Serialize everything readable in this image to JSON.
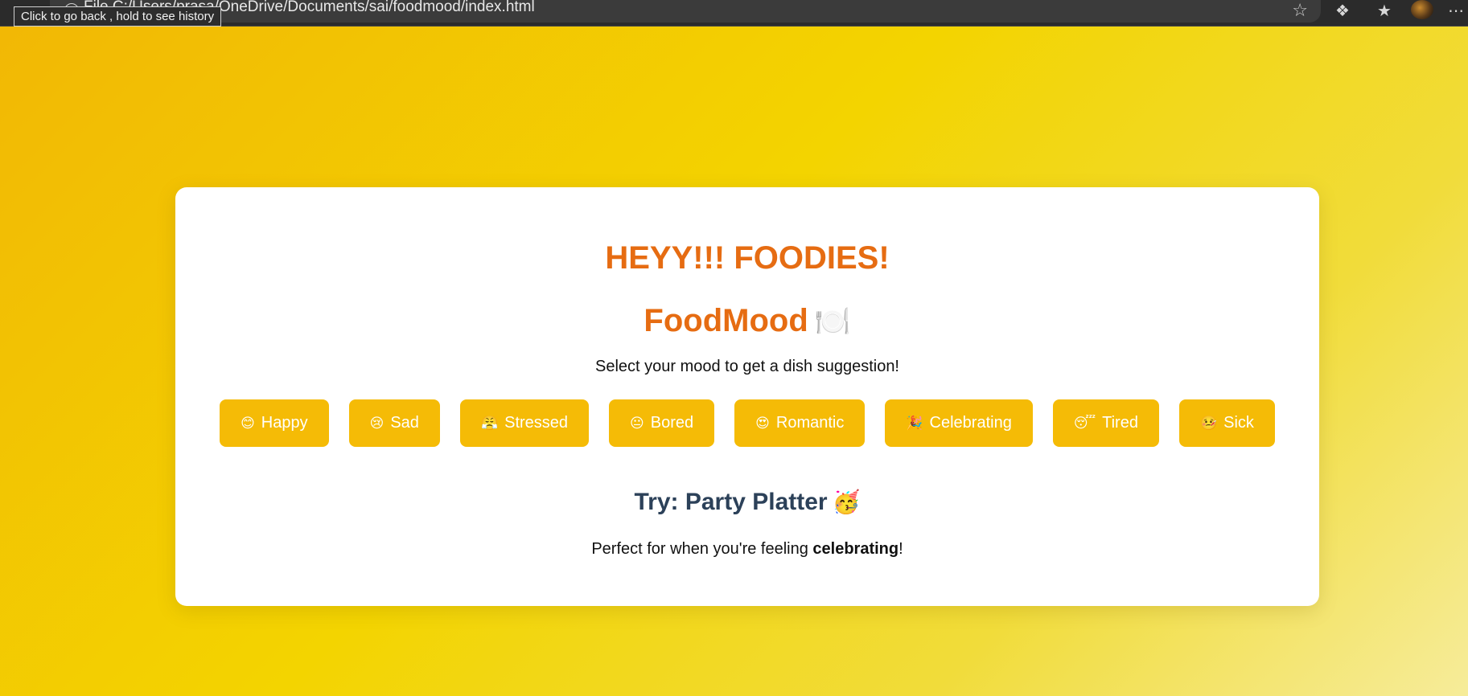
{
  "browser": {
    "url": "File    C:/Users/prasa/OneDrive/Documents/sai/foodmood/index.html",
    "tooltip": "Click to go back , hold to see history",
    "back_icon": "back-arrow-icon",
    "info_icon": "info-icon",
    "favorite_icon": "star-icon"
  },
  "page": {
    "headline": "HEYY!!! FOODIES!",
    "brand": "FoodMood",
    "brand_emoji": "🍽️",
    "subtitle": "Select your mood to get a dish suggestion!",
    "moods": [
      {
        "emoji": "😊",
        "label": "Happy"
      },
      {
        "emoji": "😢",
        "label": "Sad"
      },
      {
        "emoji": "😤",
        "label": "Stressed"
      },
      {
        "emoji": "😐",
        "label": "Bored"
      },
      {
        "emoji": "😍",
        "label": "Romantic"
      },
      {
        "emoji": "🎉",
        "label": "Celebrating"
      },
      {
        "emoji": "😴",
        "label": "Tired"
      },
      {
        "emoji": "🤒",
        "label": "Sick"
      }
    ],
    "suggestion": {
      "prefix": "Try: Party Platter",
      "emoji": "🥳",
      "reason_before": "Perfect for when you're feeling ",
      "reason_mood": "celebrating",
      "reason_after": "!"
    }
  },
  "colors": {
    "accent": "#e66c12",
    "button": "#f5bb06",
    "suggestion_text": "#2c4159"
  }
}
